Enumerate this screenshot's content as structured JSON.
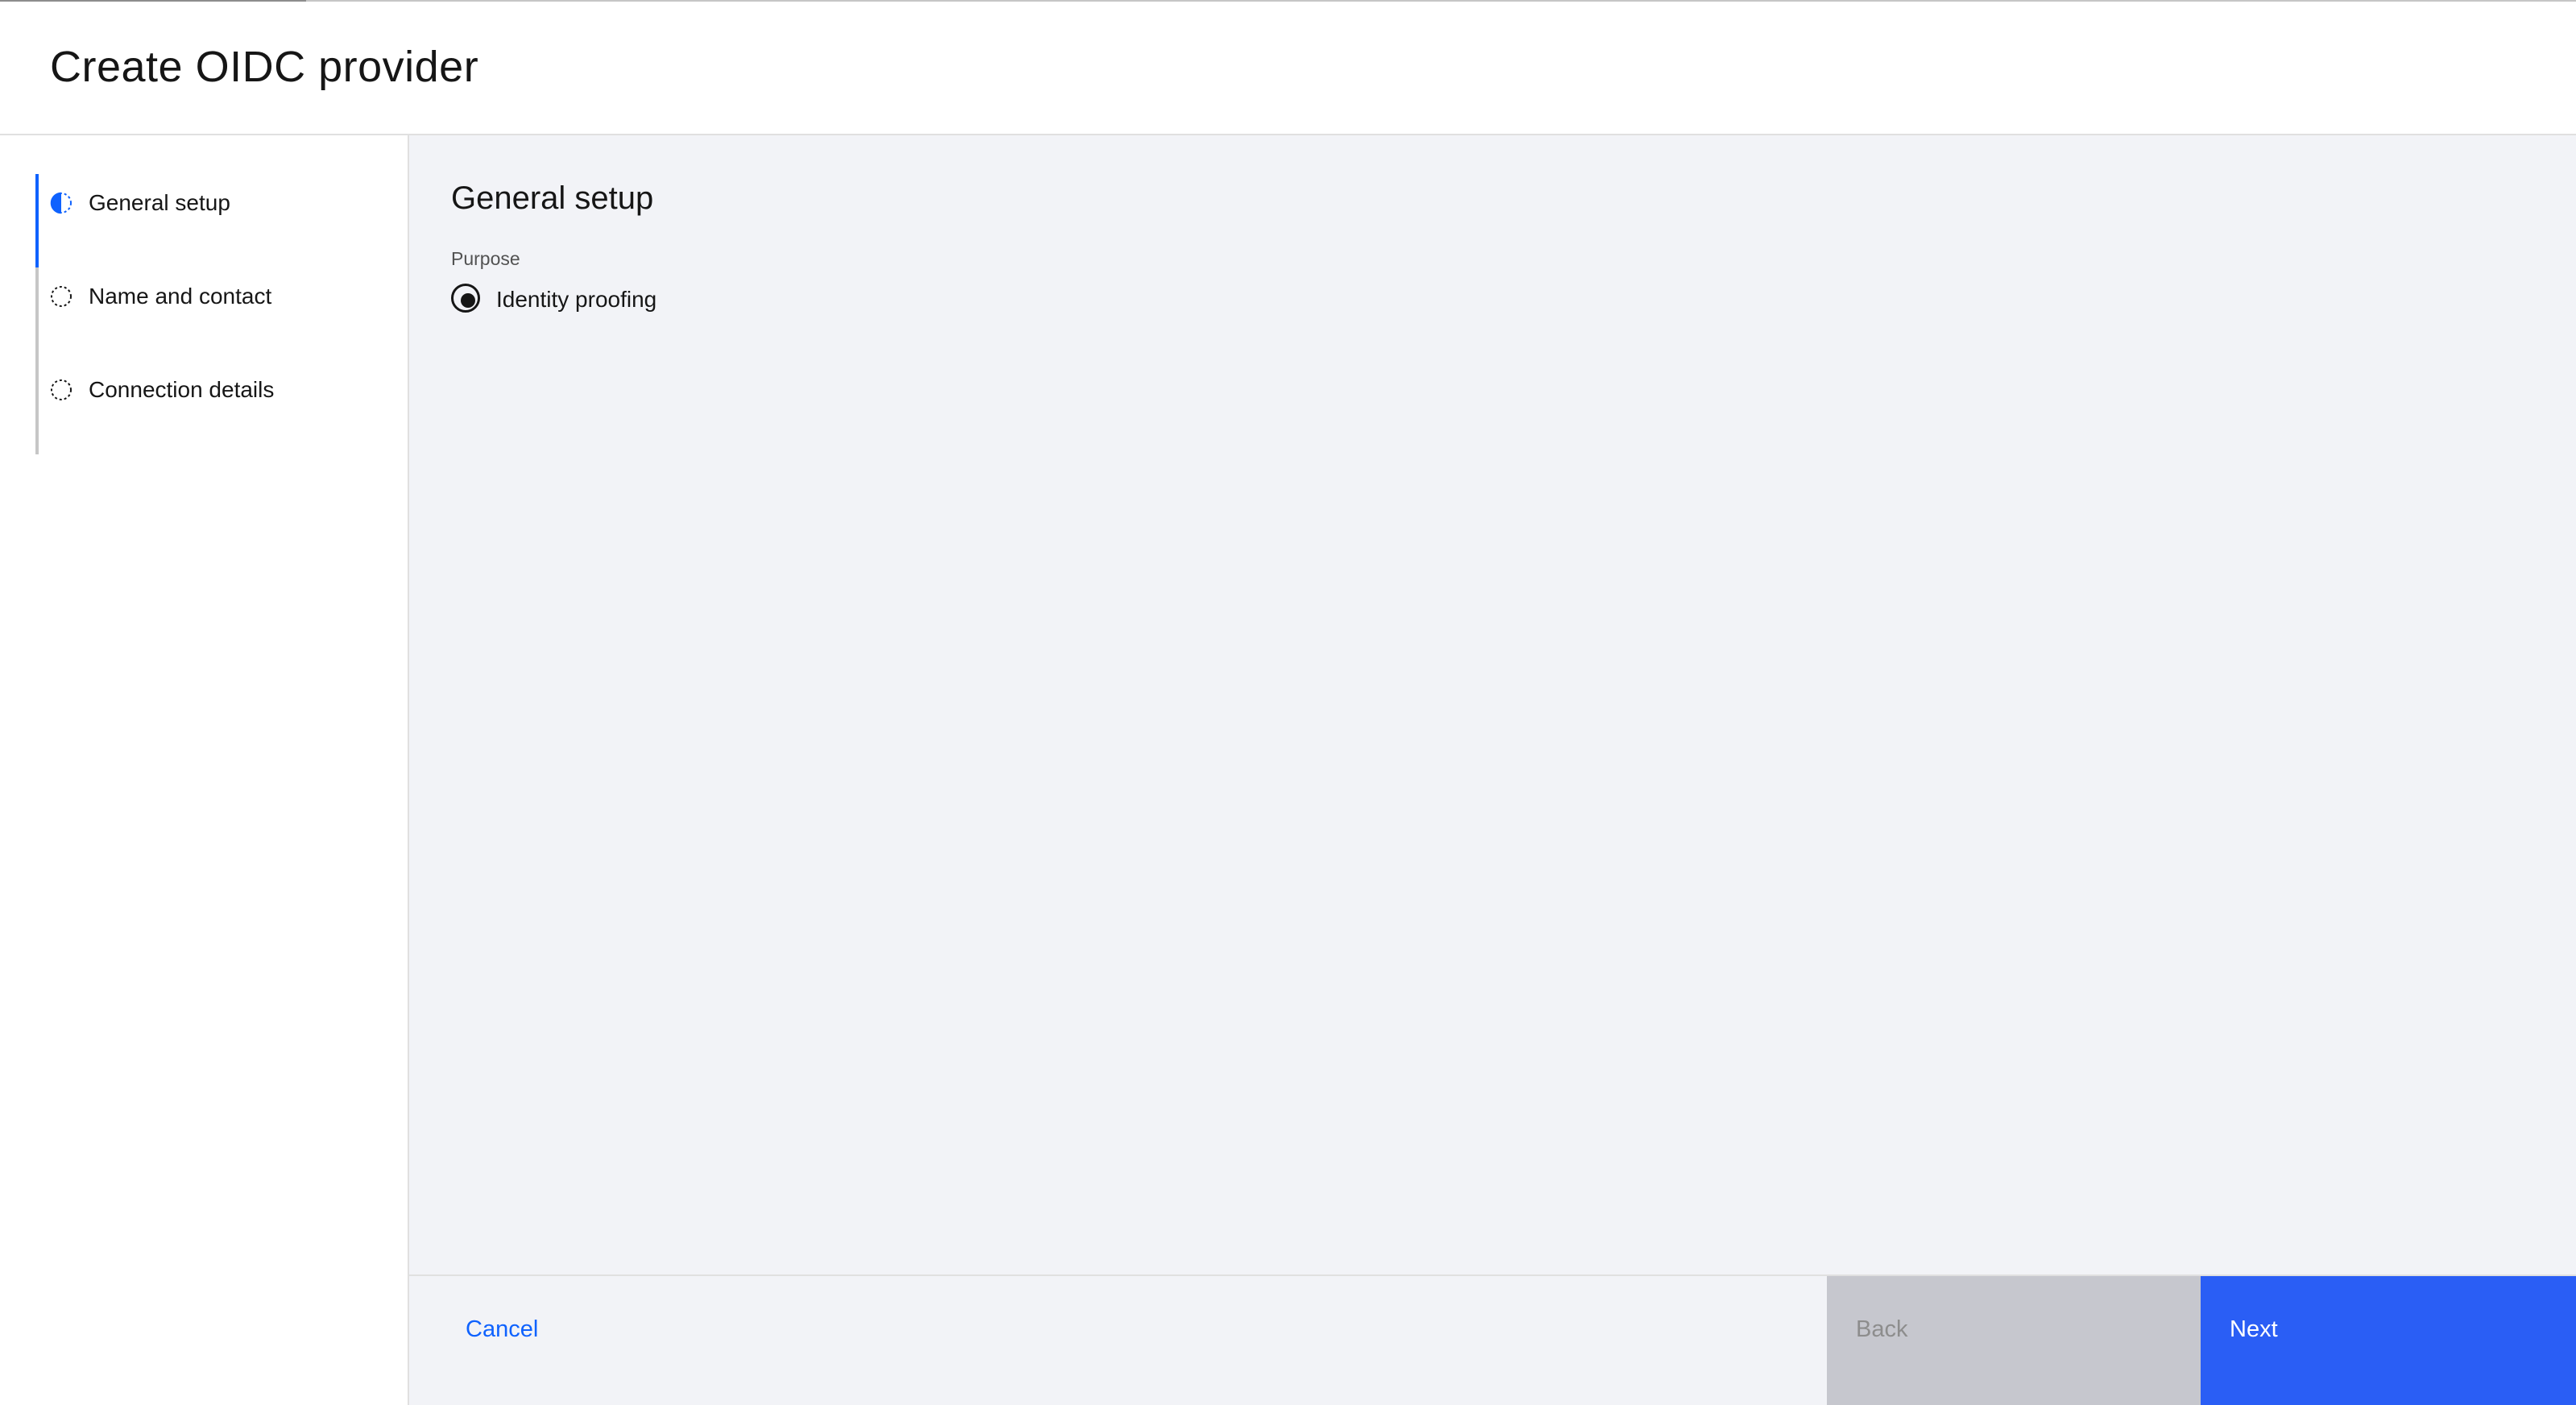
{
  "page": {
    "title": "Create OIDC provider"
  },
  "sidebar": {
    "steps": [
      {
        "label": "General setup",
        "state": "current",
        "icon": "half-circle-icon"
      },
      {
        "label": "Name and contact",
        "state": "incomplete",
        "icon": "dashed-circle-icon"
      },
      {
        "label": "Connection details",
        "state": "incomplete",
        "icon": "dashed-circle-icon"
      }
    ]
  },
  "main": {
    "heading": "General setup",
    "purpose": {
      "label": "Purpose",
      "options": [
        {
          "label": "Identity proofing",
          "selected": true
        }
      ]
    }
  },
  "footer": {
    "cancel_label": "Cancel",
    "back_label": "Back",
    "back_disabled": true,
    "next_label": "Next"
  },
  "colors": {
    "accent": "#0f62fe",
    "primary_button": "#2a5ef5",
    "disabled_button": "#c6c7ce",
    "content_background": "#f2f3f7"
  }
}
